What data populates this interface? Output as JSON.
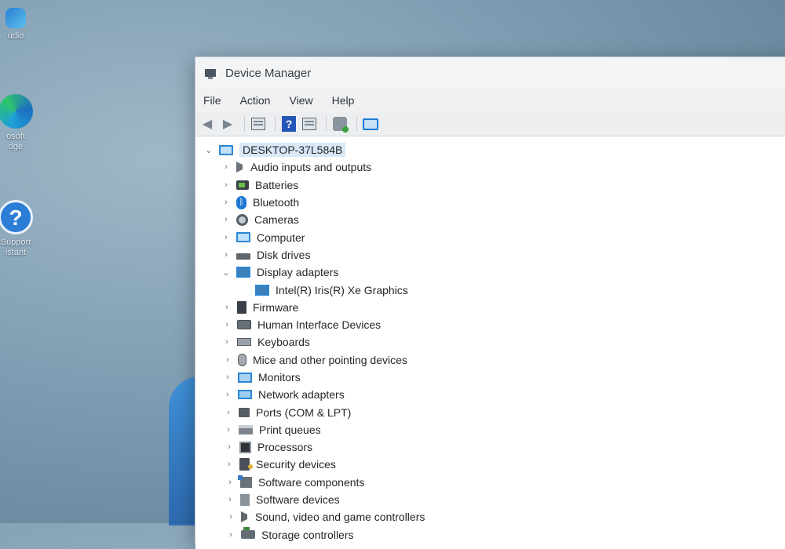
{
  "desktop": {
    "icons": [
      {
        "label": "udio",
        "icon": "app-icon"
      },
      {
        "label": "osoft\ndge",
        "icon": "edge-icon"
      },
      {
        "label": "Support\nistant",
        "icon": "help-icon"
      }
    ]
  },
  "window": {
    "title": "Device Manager",
    "menu": [
      "File",
      "Action",
      "View",
      "Help"
    ],
    "toolbar": [
      "back-arrow-icon",
      "forward-arrow-icon",
      "properties-icon",
      "help-icon",
      "view-icon",
      "scan-hardware-icon",
      "monitor-icon"
    ]
  },
  "tree": {
    "root": "DESKTOP-37L584B",
    "items": [
      {
        "label": "Audio inputs and outputs",
        "icon": "speaker-icon",
        "expanded": false
      },
      {
        "label": "Batteries",
        "icon": "battery-icon",
        "expanded": false
      },
      {
        "label": "Bluetooth",
        "icon": "bluetooth-icon",
        "expanded": false
      },
      {
        "label": "Cameras",
        "icon": "camera-icon",
        "expanded": false
      },
      {
        "label": "Computer",
        "icon": "computer-icon",
        "expanded": false
      },
      {
        "label": "Disk drives",
        "icon": "disk-drive-icon",
        "expanded": false
      },
      {
        "label": "Display adapters",
        "icon": "display-adapter-icon",
        "expanded": true
      },
      {
        "label": "Intel(R) Iris(R) Xe Graphics",
        "icon": "display-adapter-icon",
        "child": true
      },
      {
        "label": "Firmware",
        "icon": "firmware-icon",
        "expanded": false
      },
      {
        "label": "Human Interface Devices",
        "icon": "hid-icon",
        "expanded": false
      },
      {
        "label": "Keyboards",
        "icon": "keyboard-icon",
        "expanded": false
      },
      {
        "label": "Mice and other pointing devices",
        "icon": "mouse-icon",
        "expanded": false
      },
      {
        "label": "Monitors",
        "icon": "monitor-icon",
        "expanded": false
      },
      {
        "label": "Network adapters",
        "icon": "network-adapter-icon",
        "expanded": false
      },
      {
        "label": "Ports (COM & LPT)",
        "icon": "port-icon",
        "expanded": false
      },
      {
        "label": "Print queues",
        "icon": "printer-icon",
        "expanded": false
      },
      {
        "label": "Processors",
        "icon": "processor-icon",
        "expanded": false
      },
      {
        "label": "Security devices",
        "icon": "security-device-icon",
        "expanded": false
      },
      {
        "label": "Software components",
        "icon": "software-component-icon",
        "expanded": false
      },
      {
        "label": "Software devices",
        "icon": "software-device-icon",
        "expanded": false
      },
      {
        "label": "Sound, video and game controllers",
        "icon": "sound-icon",
        "expanded": false
      },
      {
        "label": "Storage controllers",
        "icon": "storage-controller-icon",
        "expanded": false
      }
    ]
  }
}
